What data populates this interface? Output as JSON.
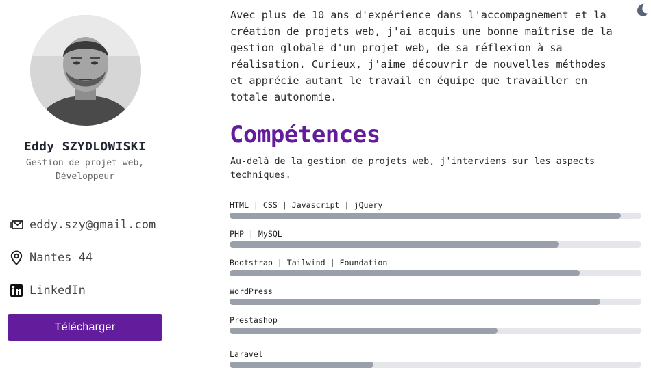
{
  "profile": {
    "name": "Eddy SZYDLOWISKI",
    "role_line1": "Gestion de projet web,",
    "role_line2": "Développeur"
  },
  "contacts": {
    "email": "eddy.szy@gmail.com",
    "location": "Nantes 44",
    "linkedin": "LinkedIn"
  },
  "download_label": "Télécharger",
  "intro": {
    "lines": [
      "Avec plus de 10 ans d'expérience dans l'accompagnement et la",
      "création de projets web, j'ai acquis une bonne maîtrise de la",
      "gestion globale d'un projet web, de sa réflexion à sa",
      "réalisation. Curieux, j'aime découvrir de nouvelles méthodes",
      "et apprécie autant le travail en équipe que travailler en",
      "totale autonomie."
    ]
  },
  "skills_section": {
    "title": "Compétences",
    "subtitle_line1": "Au-delà de la gestion de projets web, j'interviens sur les aspects",
    "subtitle_line2": "techniques.",
    "items": [
      {
        "label": "HTML | CSS | Javascript | jQuery",
        "level": 0.95
      },
      {
        "label": "PHP | MySQL",
        "level": 0.8
      },
      {
        "label": "Bootstrap | Tailwind | Foundation",
        "level": 0.85
      },
      {
        "label": "WordPress",
        "level": 0.9
      },
      {
        "label": "Prestashop",
        "level": 0.65
      },
      {
        "label": "Laravel",
        "level": 0.35
      }
    ]
  },
  "colors": {
    "accent": "#631c9c",
    "bar_fill": "#9aa0aa",
    "bar_track": "#e5e6ea"
  },
  "icons": {
    "email": "email-send-icon",
    "location": "map-pin-icon",
    "linkedin": "linkedin-icon",
    "theme": "moon-icon"
  }
}
